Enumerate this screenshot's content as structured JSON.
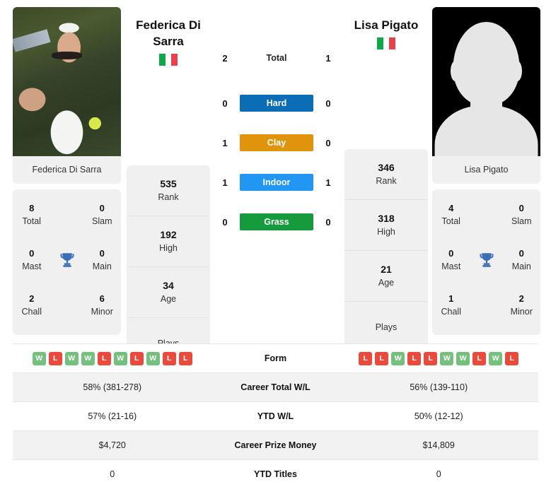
{
  "players": {
    "left": {
      "name": "Federica Di Sarra",
      "name_header": "Federica Di Sarra",
      "country": "Italy",
      "photo_kind": "player-photo",
      "titles": {
        "total": "8",
        "total_label": "Total",
        "slam": "0",
        "slam_label": "Slam",
        "mast": "0",
        "mast_label": "Mast",
        "main": "0",
        "main_label": "Main",
        "chall": "2",
        "chall_label": "Chall",
        "minor": "6",
        "minor_label": "Minor"
      },
      "rank": "535",
      "high": "192",
      "age": "34",
      "plays": "",
      "form": [
        "W",
        "L",
        "W",
        "W",
        "L",
        "W",
        "L",
        "W",
        "L",
        "L"
      ],
      "career_wl": "58% (381-278)",
      "ytd_wl": "57% (21-16)",
      "career_prize": "$4,720",
      "ytd_titles": "0"
    },
    "right": {
      "name": "Lisa Pigato",
      "name_header": "Lisa Pigato",
      "country": "Italy",
      "photo_kind": "silhouette-placeholder",
      "titles": {
        "total": "4",
        "total_label": "Total",
        "slam": "0",
        "slam_label": "Slam",
        "mast": "0",
        "mast_label": "Mast",
        "main": "0",
        "main_label": "Main",
        "chall": "1",
        "chall_label": "Chall",
        "minor": "2",
        "minor_label": "Minor"
      },
      "rank": "346",
      "high": "318",
      "age": "21",
      "plays": "",
      "form": [
        "L",
        "L",
        "W",
        "L",
        "L",
        "W",
        "W",
        "L",
        "W",
        "L"
      ],
      "career_wl": "56% (139-110)",
      "ytd_wl": "50% (12-12)",
      "career_prize": "$14,809",
      "ytd_titles": "0"
    }
  },
  "labels": {
    "rank": "Rank",
    "high": "High",
    "age": "Age",
    "plays": "Plays"
  },
  "h2h": {
    "total": {
      "label": "Total",
      "left": "2",
      "right": "1"
    },
    "surfaces": [
      {
        "label": "Hard",
        "left": "0",
        "right": "0",
        "color": "#0a6db5"
      },
      {
        "label": "Clay",
        "left": "1",
        "right": "0",
        "color": "#e0940b"
      },
      {
        "label": "Indoor",
        "left": "1",
        "right": "1",
        "color": "#2196f3"
      },
      {
        "label": "Grass",
        "left": "0",
        "right": "0",
        "color": "#159a3c"
      }
    ]
  },
  "stats_table": {
    "rows": [
      {
        "label": "Form",
        "type": "form"
      },
      {
        "label": "Career Total W/L",
        "type": "text",
        "left": "58% (381-278)",
        "right": "56% (139-110)"
      },
      {
        "label": "YTD W/L",
        "type": "text",
        "left": "57% (21-16)",
        "right": "50% (12-12)"
      },
      {
        "label": "Career Prize Money",
        "type": "text",
        "left": "$4,720",
        "right": "$14,809"
      },
      {
        "label": "YTD Titles",
        "type": "text",
        "left": "0",
        "right": "0"
      }
    ]
  },
  "colors": {
    "win": "#75c07d",
    "loss": "#ea4a3b",
    "card_bg": "#f0f0f0",
    "row_stripe": "#f2f2f2"
  }
}
